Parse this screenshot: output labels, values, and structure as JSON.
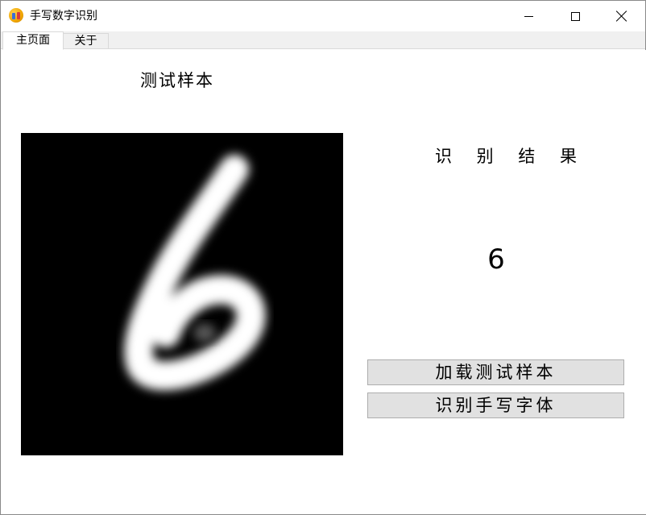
{
  "window": {
    "title": "手写数字识别",
    "icon": "app-icon"
  },
  "tabs": [
    {
      "label": "主页面",
      "active": true
    },
    {
      "label": "关于",
      "active": false
    }
  ],
  "main": {
    "sample_title": "测试样本",
    "result_title": "识 别 结 果",
    "result_value": "6",
    "load_button": "加载测试样本",
    "recognize_button": "识别手写字体"
  },
  "colors": {
    "button_bg": "#e1e1e1",
    "button_border": "#adadad",
    "image_bg": "#000000",
    "digit": "#ffffff"
  }
}
